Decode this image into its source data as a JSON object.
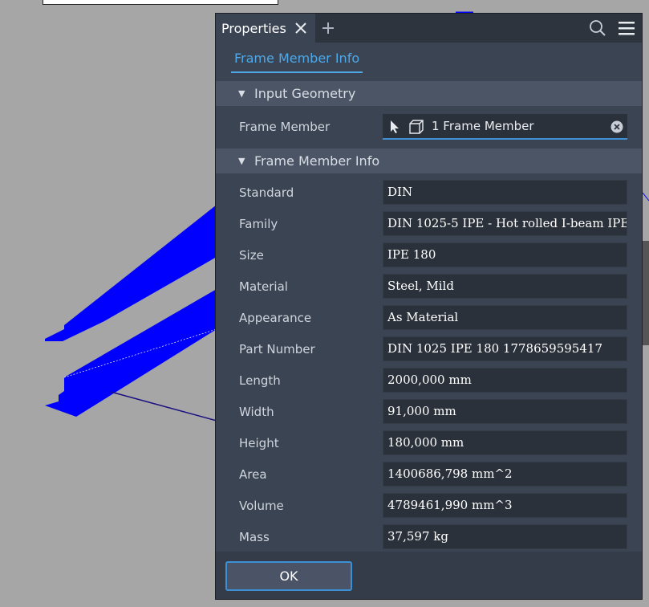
{
  "panel": {
    "title": "Properties",
    "tab_icons": {
      "close": "close-icon",
      "add": "plus-icon",
      "search": "search-icon",
      "menu": "hamburger-menu-icon"
    },
    "subtab": "Frame Member Info"
  },
  "input_geometry": {
    "heading": "Input Geometry",
    "label": "Frame Member",
    "selector_value": "1 Frame Member"
  },
  "info": {
    "heading": "Frame Member Info",
    "rows": [
      {
        "label": "Standard",
        "value": "DIN"
      },
      {
        "label": "Family",
        "value": "DIN 1025-5 IPE - Hot rolled I-beam IPE"
      },
      {
        "label": "Size",
        "value": "IPE 180"
      },
      {
        "label": "Material",
        "value": "Steel, Mild"
      },
      {
        "label": "Appearance",
        "value": "As Material"
      },
      {
        "label": "Part Number",
        "value": "DIN 1025 IPE 180 1778659595417"
      },
      {
        "label": "Length",
        "value": "2000,000 mm"
      },
      {
        "label": "Width",
        "value": "91,000 mm"
      },
      {
        "label": "Height",
        "value": "180,000 mm"
      },
      {
        "label": "Area",
        "value": "1400686,798 mm^2"
      },
      {
        "label": "Volume",
        "value": "4789461,990 mm^3"
      },
      {
        "label": "Mass",
        "value": "37,597 kg"
      }
    ]
  },
  "footer": {
    "ok_label": "OK"
  },
  "colors": {
    "accent": "#4fa8e8",
    "beam": "#0000ff",
    "panel_bg": "#3b4453"
  }
}
